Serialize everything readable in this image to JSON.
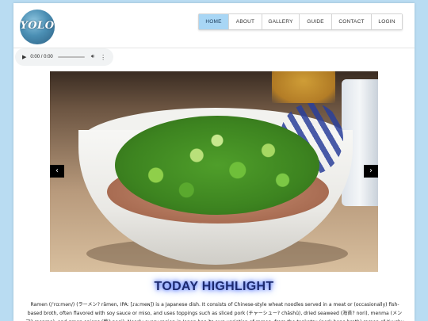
{
  "header": {
    "logo_text": "YOLO",
    "nav": [
      {
        "label": "HOME",
        "active": true
      },
      {
        "label": "ABOUT",
        "active": false
      },
      {
        "label": "GALLERY",
        "active": false
      },
      {
        "label": "GUIDE",
        "active": false
      },
      {
        "label": "CONTACT",
        "active": false
      },
      {
        "label": "LOGIN",
        "active": false
      }
    ]
  },
  "audio_player": {
    "time": "0:00 / 0:00",
    "play_icon": "play-icon",
    "volume_icon": "volume-icon",
    "menu_icon": "more-vert-icon"
  },
  "carousel": {
    "prev_label": "‹",
    "next_label": "›"
  },
  "highlight": {
    "title": "TODAY HIGHLIGHT",
    "text": "Ramen (/ˈrɑːmən/) (ラーメン? rāmen, IPA: [ɾaːmeɴ]) is a Japanese dish. It consists of Chinese-style wheat noodles served in a meat or (occasionally) fish-based broth, often flavored with soy sauce or miso, and uses toppings such as sliced pork (チャーシュー? chāshū), dried seaweed (海苔? nori), menma (メンマ? menma), and green onions (葱? negi). Nearly every region in Japan has its own variation of ramen, from the tonkotsu (pork bone broth) ramen of Kyushu to the"
  },
  "colors": {
    "background": "#b9dcf2",
    "nav_active": "#a8d6f5",
    "highlight_glow": "#5a7cff"
  }
}
